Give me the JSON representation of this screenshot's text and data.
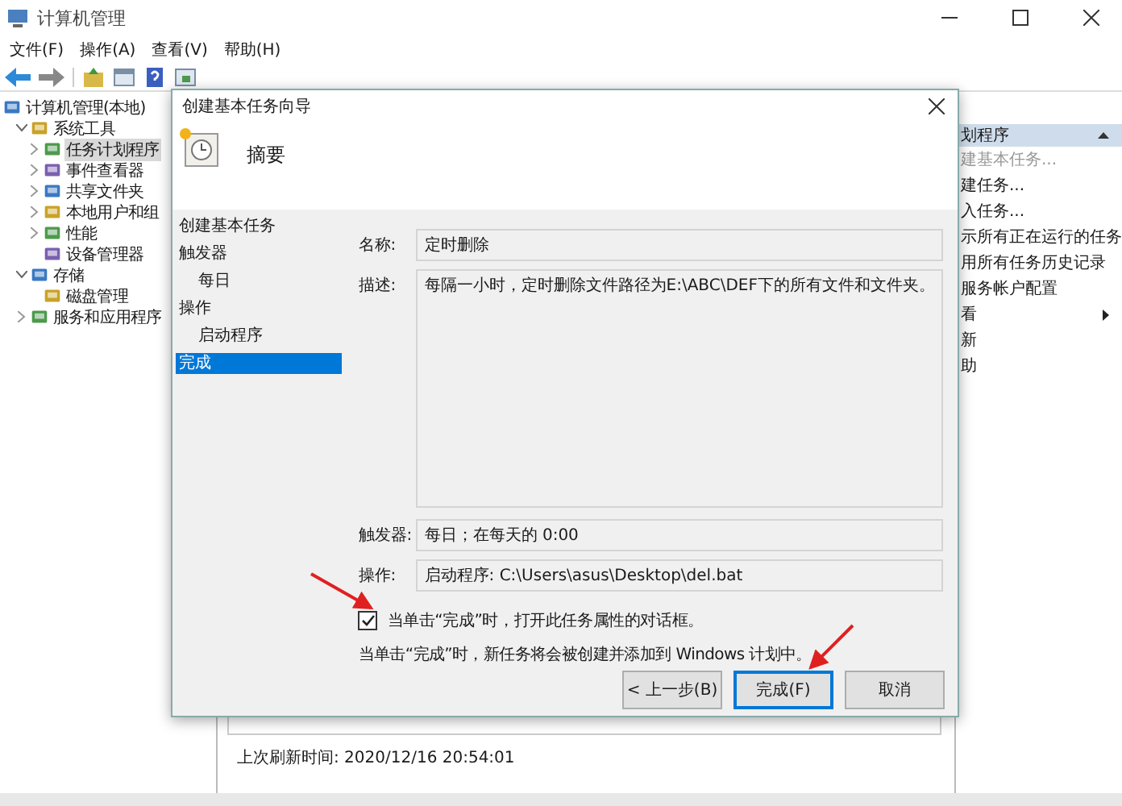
{
  "window": {
    "title": "计算机管理"
  },
  "menu": [
    "文件(F)",
    "操作(A)",
    "查看(V)",
    "帮助(H)"
  ],
  "tree": [
    {
      "label": "计算机管理(本地)",
      "selected": false,
      "children": [
        {
          "label": "系统工具",
          "expanded": true,
          "selected": false,
          "children": [
            {
              "label": "任务计划程序",
              "expanded": false,
              "selected": true
            },
            {
              "label": "事件查看器",
              "expanded": false,
              "selected": false
            },
            {
              "label": "共享文件夹",
              "expanded": false,
              "selected": false
            },
            {
              "label": "本地用户和组",
              "expanded": false,
              "selected": false
            },
            {
              "label": "性能",
              "expanded": false,
              "selected": false
            },
            {
              "label": "设备管理器",
              "selected": false
            }
          ]
        },
        {
          "label": "存储",
          "expanded": true,
          "selected": false,
          "children": [
            {
              "label": "磁盘管理",
              "selected": false
            }
          ]
        },
        {
          "label": "服务和应用程序",
          "expanded": false,
          "selected": false
        }
      ]
    }
  ],
  "status": {
    "last_refresh": "上次刷新时间: 2020/12/16 20:54:01"
  },
  "actions": {
    "title": "划程序",
    "items": [
      {
        "label": "建基本任务...",
        "disabled": true,
        "submenu": false
      },
      {
        "label": "建任务...",
        "disabled": false,
        "submenu": false
      },
      {
        "label": "入任务...",
        "disabled": false,
        "submenu": false
      },
      {
        "label": "示所有正在运行的任务",
        "disabled": false,
        "submenu": false
      },
      {
        "label": "用所有任务历史记录",
        "disabled": false,
        "submenu": false
      },
      {
        "label": "服务帐户配置",
        "disabled": false,
        "submenu": false
      },
      {
        "label": "看",
        "disabled": false,
        "submenu": true
      },
      {
        "label": "新",
        "disabled": false,
        "submenu": false
      },
      {
        "label": "助",
        "disabled": false,
        "submenu": false
      }
    ]
  },
  "dialog": {
    "title": "创建基本任务向导",
    "heading": "摘要",
    "steps": [
      {
        "label": "创建基本任务",
        "selected": false
      },
      {
        "label": "触发器",
        "selected": false,
        "children": [
          {
            "label": "每日",
            "selected": false
          }
        ]
      },
      {
        "label": "操作",
        "selected": false,
        "children": [
          {
            "label": "启动程序",
            "selected": false
          }
        ]
      },
      {
        "label": "完成",
        "selected": true
      }
    ],
    "fields": [
      {
        "label": "名称:",
        "value": "定时删除",
        "kind": "single"
      },
      {
        "label": "描述:",
        "value": "每隔一小时，定时删除文件路径为E:\\ABC\\DEF下的所有文件和文件夹。",
        "kind": "multi"
      },
      {
        "label": "触发器:",
        "value": "每日；在每天的 0:00",
        "kind": "single"
      },
      {
        "label": "操作:",
        "value": "启动程序: C:\\Users\\asus\\Desktop\\del.bat",
        "kind": "single"
      }
    ],
    "open_properties": {
      "label": "当单击“完成”时，打开此任务属性的对话框。",
      "checked": true
    },
    "note": "当单击“完成”时，新任务将会被创建并添加到 Windows 计划中。",
    "buttons": [
      {
        "label": "< 上一步(B)",
        "default": false
      },
      {
        "label": "完成(F)",
        "default": true
      },
      {
        "label": "取消",
        "default": false
      }
    ]
  }
}
